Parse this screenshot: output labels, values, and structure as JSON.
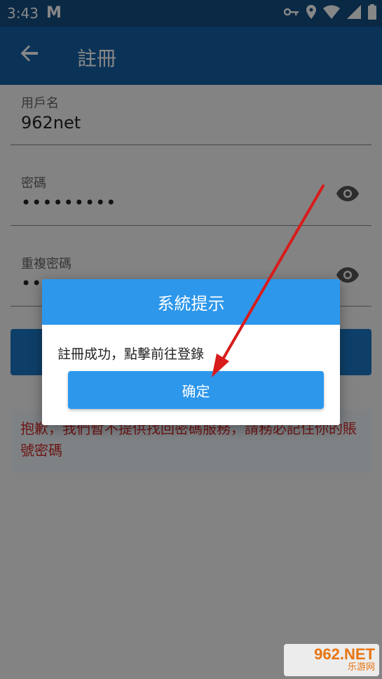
{
  "status_bar": {
    "time": "3:43",
    "app_icon": "M"
  },
  "app_bar": {
    "title": "註冊"
  },
  "form": {
    "username_label": "用戶名",
    "username_value": "962net",
    "password_label": "密碼",
    "password_value": "•••••••••",
    "confirm_label": "重複密碼",
    "confirm_value": "•••••••••"
  },
  "notice": {
    "text": "抱歉，我們暫不提供找回密碼服務，請務必記住你的賬號密碼"
  },
  "dialog": {
    "title": "系統提示",
    "message": "註冊成功，點擊前往登錄",
    "confirm_label": "确定"
  },
  "watermark": {
    "top": "962.NET",
    "bottom": "乐游网"
  },
  "colors": {
    "app_bar": "#1560a6",
    "dialog_accent": "#2d97ec",
    "notice_text": "#d02a2a",
    "arrow": "#d81b1b"
  }
}
